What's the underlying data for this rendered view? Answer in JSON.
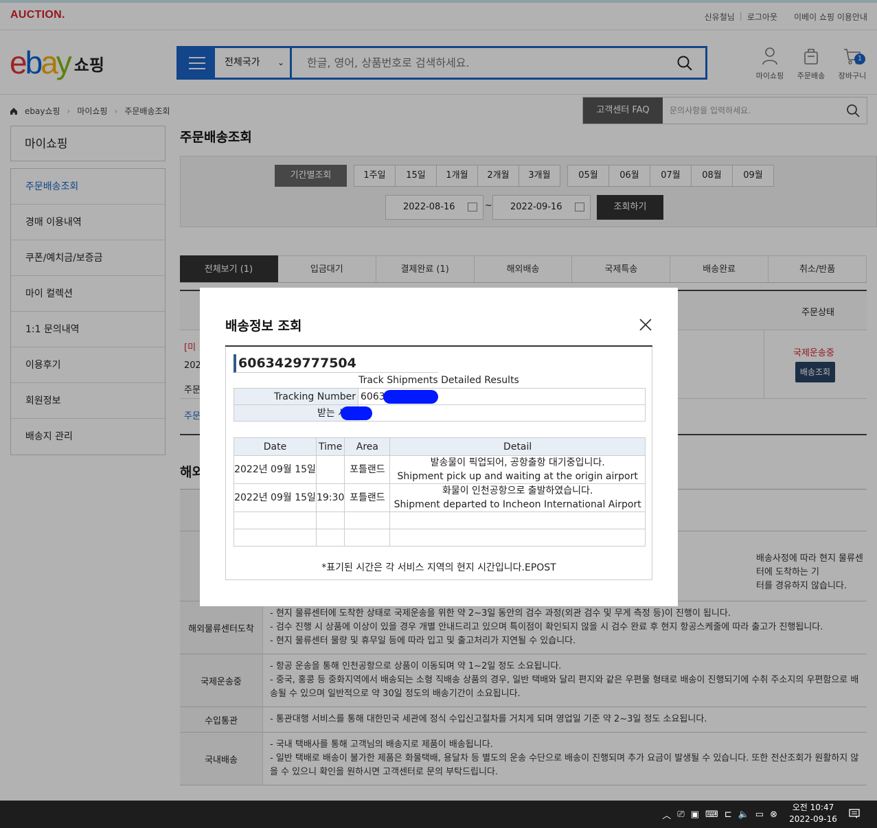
{
  "topbar": {
    "brand": "AUCTION.",
    "links": [
      "신유철님",
      "로그아웃",
      "이베이 쇼핑 이용안내"
    ]
  },
  "header": {
    "logo_suffix": "쇼핑",
    "country": "전체국가",
    "search_placeholder": "한글, 영어, 상품번호로 검색하세요.",
    "icons": [
      {
        "label": "마이쇼핑",
        "icon": "user-icon"
      },
      {
        "label": "주문배송",
        "icon": "box-icon"
      },
      {
        "label": "장바구니",
        "icon": "cart-icon",
        "badge": "1"
      }
    ]
  },
  "breadcrumb": [
    "ebay쇼핑",
    "마이쇼핑",
    "주문배송조회"
  ],
  "faq": {
    "button": "고객센터 FAQ",
    "placeholder": "문의사항을 입력하세요."
  },
  "sidebar": {
    "title": "마이쇼핑",
    "items": [
      "주문배송조회",
      "경매 이용내역",
      "쿠폰/예치금/보증금",
      "마이 컬렉션",
      "1:1 문의내역",
      "이용후기",
      "회원정보",
      "배송지 관리"
    ]
  },
  "page_title": "주문배송조회",
  "period": {
    "label": "기간별조회",
    "ranges": [
      "1주일",
      "15일",
      "1개월",
      "2개월",
      "3개월"
    ],
    "months": [
      "05월",
      "06월",
      "07월",
      "08월",
      "09월"
    ],
    "start": "2022-08-16",
    "tilde": "~",
    "end": "2022-09-16",
    "button": "조회하기"
  },
  "tabs": [
    "전체보기 (1)",
    "입금대기",
    "결제완료 (1)",
    "해외배송",
    "국제특송",
    "배송완료",
    "취소/반품"
  ],
  "order": {
    "status_header": "주문상태",
    "frag1": "[미",
    "frag2": "202",
    "frag3": "주문",
    "frag4": "주문",
    "status": "국제운송중",
    "track_button": "배송조회"
  },
  "info": {
    "title_frag": "해외",
    "hidden_frag1": "배송사정에 따라 현지 물류센터에 도착하는 기",
    "hidden_frag2": "터를 경유하지 않습니다.",
    "rows": [
      {
        "stage": "해외물류센터도착",
        "lines": [
          "- 현지 물류센터에 도착한 상태로 국제운송을 위한 약 2~3일 동안의 검수 과정(외관 검수 및 무게 측정 등)이 진행이 됩니다.",
          "- 검수 진행 시 상품에 이상이 있을 경우 개별 안내드리고 있으며 특이점이 확인되지 않을 시 검수 완료 후 현지 항공스케줄에 따라 출고가 진행됩니다.",
          "- 현지 물류센터 물량 및 휴무일 등에 따라 입고 및 출고처리가 지연될 수 있습니다."
        ]
      },
      {
        "stage": "국제운송중",
        "lines": [
          "- 항공 운송을 통해 인천공항으로 상품이 이동되며 약 1~2일 정도 소요됩니다.",
          "- 중국, 홍콩 등 중화지역에서 배송되는 소형 직배송 상품의 경우, 일반 택배와 달리 편지와 같은 우편물 형태로 배송이 진행되기에 수취 주소지의 우편함으로 배송될 수 있으며 일반적으로 약 30일 정도의 배송기간이 소요됩니다."
        ]
      },
      {
        "stage": "수입통관",
        "lines": [
          "- 통관대행 서비스를 통해 대한민국 세관에 정식 수입신고절차를 거치게 되며 영업일 기준 약 2~3일 정도 소요됩니다."
        ]
      },
      {
        "stage": "국내배송",
        "lines": [
          "- 국내 택배사를 통해 고객님의 배송지로 제품이 배송됩니다.",
          "- 일반 택배로 배송이 불가한 제품은 화물택배, 용달차 등 별도의 운송 수단으로 배송이 진행되며 추가 요금이 발생될 수 있습니다. 또한 전산조회가 원활하지 않을 수 있으니 확인을 원하시면 고객센터로 문의 부탁드립니다."
        ]
      }
    ]
  },
  "modal": {
    "title": "배송정보 조회",
    "tracking_number": "6063429777504",
    "subtitle": "Track Shipments Detailed Results",
    "tracking_label": "Tracking Number",
    "tracking_value_partial": "6063",
    "receiver_label": "받는 사람",
    "columns": [
      "Date",
      "Time",
      "Area",
      "Detail"
    ],
    "events": [
      {
        "date": "2022년 09월 15일",
        "time": "",
        "area": "포틀랜드",
        "detail_ko": "발송물이 픽업되어, 공항출항 대기중입니다.",
        "detail_en": "Shipment pick up and waiting at the origin airport"
      },
      {
        "date": "2022년 09월 15일",
        "time": "19:30",
        "area": "포틀랜드",
        "detail_ko": "화물이 인천공항으로 출발하였습니다.",
        "detail_en": "Shipment departed to Incheon International Airport"
      }
    ],
    "footnote": "*표기된 시간은 각 서비스 지역의 현지 시간입니다.EPOST"
  },
  "taskbar": {
    "time": "오전 10:47",
    "date": "2022-09-16"
  }
}
